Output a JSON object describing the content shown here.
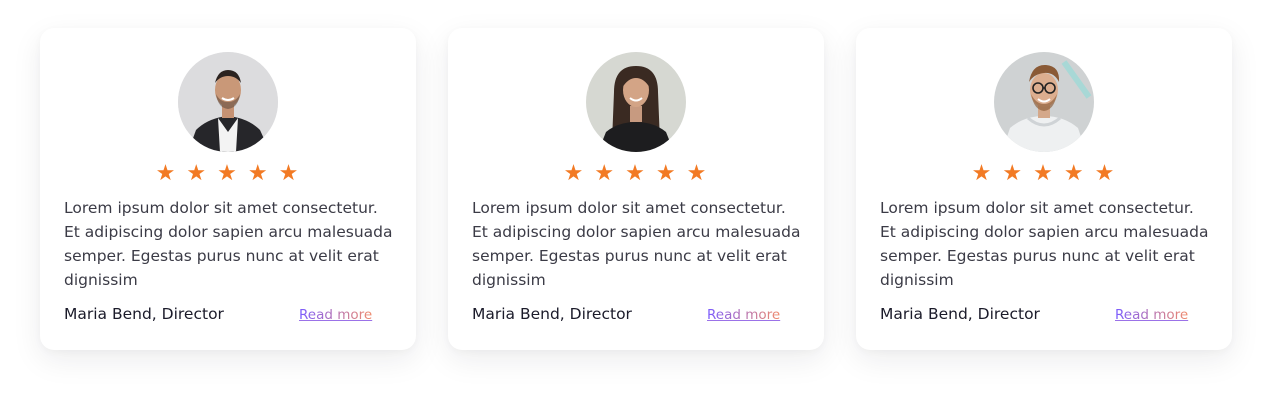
{
  "testimonials": [
    {
      "rating": 5,
      "stars": [
        "★",
        "★",
        "★",
        "★",
        "★"
      ],
      "text": "Lorem ipsum dolor sit amet consectetur. Et adipiscing dolor sapien arcu malesuada semper. Egestas purus nunc at velit erat dignissim",
      "author": "Maria Bend, Director",
      "link_label": "Read more",
      "avatar_icon": "man-in-suit-avatar"
    },
    {
      "rating": 5,
      "stars": [
        "★",
        "★",
        "★",
        "★",
        "★"
      ],
      "text": "Lorem ipsum dolor sit amet consectetur. Et adipiscing dolor sapien arcu malesuada semper. Egestas purus nunc at velit erat dignissim",
      "author": "Maria Bend, Director",
      "link_label": "Read more",
      "avatar_icon": "woman-dark-hair-avatar"
    },
    {
      "rating": 5,
      "stars": [
        "★",
        "★",
        "★",
        "★",
        "★"
      ],
      "text": "Lorem ipsum dolor sit amet consectetur. Et adipiscing dolor sapien arcu malesuada semper. Egestas purus nunc at velit erat dignissim",
      "author": "Maria Bend, Director",
      "link_label": "Read more",
      "avatar_icon": "man-glasses-hoodie-avatar"
    }
  ],
  "colors": {
    "star": "#f27a24",
    "link_gradient_start": "#7a5cff",
    "link_gradient_end": "#f08a6a",
    "author": "#1b1b2a",
    "body_text": "#3b3b46"
  }
}
